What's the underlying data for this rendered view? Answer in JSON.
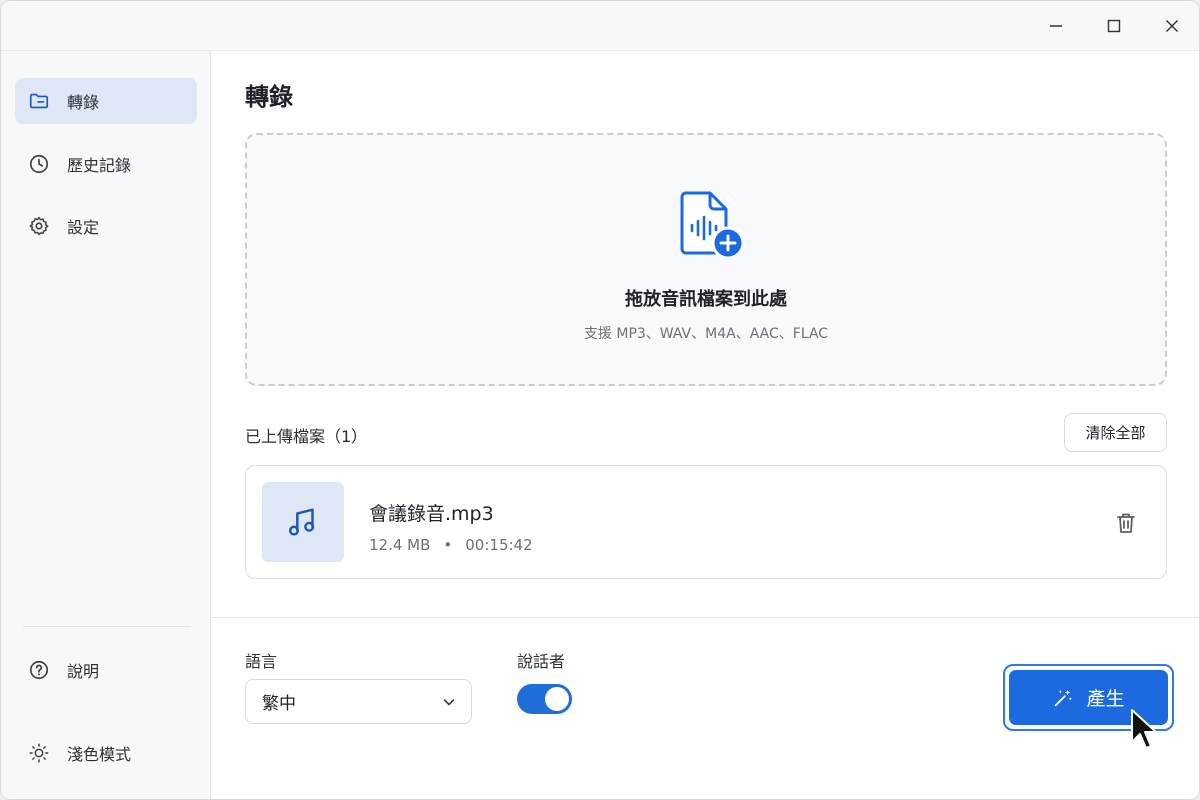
{
  "window": {
    "controls": [
      "minimize",
      "maximize",
      "close"
    ]
  },
  "sidebar": {
    "items": [
      {
        "label": "轉錄",
        "icon": "folder-icon",
        "active": true
      },
      {
        "label": "歷史記錄",
        "icon": "clock-icon",
        "active": false
      },
      {
        "label": "設定",
        "icon": "gear-icon",
        "active": false
      }
    ],
    "bottom_items": [
      {
        "label": "說明",
        "icon": "help-icon"
      },
      {
        "label": "淺色模式",
        "icon": "sun-icon"
      }
    ]
  },
  "main": {
    "title": "轉錄",
    "dropzone": {
      "title": "拖放音訊檔案到此處",
      "subtitle": "支援 MP3、WAV、M4A、AAC、FLAC",
      "icon": "audio-file-add-icon"
    },
    "uploaded_label": "已上傳檔案（1）",
    "clear_all_label": "清除全部",
    "files": [
      {
        "name": "會議錄音.mp3",
        "size": "12.4 MB",
        "separator": "•",
        "duration": "00:15:42",
        "icon": "music-note-icon"
      }
    ],
    "language": {
      "label": "語言",
      "value": "繁中"
    },
    "speakers": {
      "label": "說話者",
      "enabled": true
    },
    "generate_label": "產生"
  },
  "colors": {
    "accent": "#1d6ae0",
    "active_nav_bg": "#dde7f6",
    "sidebar_bg": "#f7f8fa"
  }
}
